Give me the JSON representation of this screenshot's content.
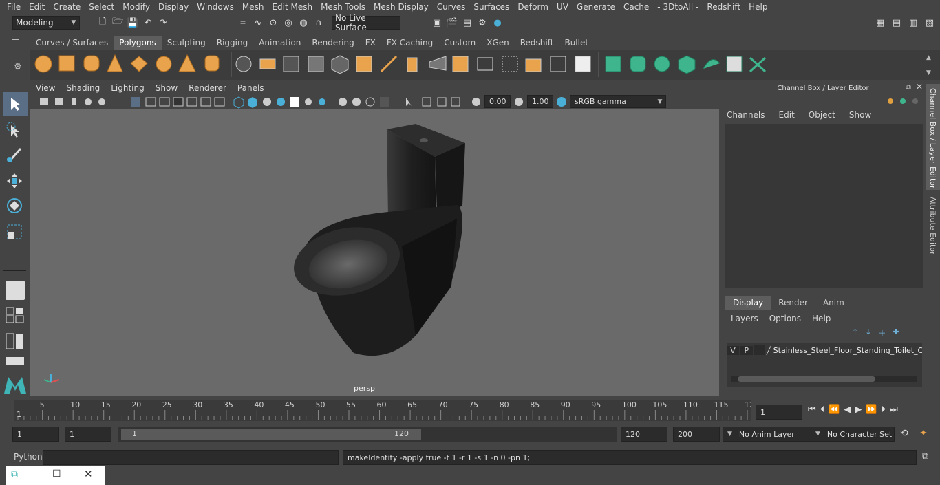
{
  "menu": [
    "File",
    "Edit",
    "Create",
    "Select",
    "Modify",
    "Display",
    "Windows",
    "Mesh",
    "Edit Mesh",
    "Mesh Tools",
    "Mesh Display",
    "Curves",
    "Surfaces",
    "Deform",
    "UV",
    "Generate",
    "Cache",
    "- 3DtoAll -",
    "Redshift",
    "Help"
  ],
  "mode_select": "Modeling",
  "live_surface": "No Live Surface",
  "shelf_tabs": [
    "Curves / Surfaces",
    "Polygons",
    "Sculpting",
    "Rigging",
    "Animation",
    "Rendering",
    "FX",
    "FX Caching",
    "Custom",
    "XGen",
    "Redshift",
    "Bullet"
  ],
  "shelf_active": "Polygons",
  "viewport_menu": [
    "View",
    "Shading",
    "Lighting",
    "Show",
    "Renderer",
    "Panels"
  ],
  "exposure": "0.00",
  "gamma": "1.00",
  "color_space": "sRGB gamma",
  "camera_label": "persp",
  "right_panel": {
    "title": "Channel Box / Layer Editor",
    "menu": [
      "Channels",
      "Edit",
      "Object",
      "Show"
    ],
    "tabs": [
      "Display",
      "Render",
      "Anim"
    ],
    "active_tab": "Display",
    "layer_menu": [
      "Layers",
      "Options",
      "Help"
    ],
    "layer": {
      "v": "V",
      "p": "P",
      "name": "Stainless_Steel_Floor_Standing_Toilet_C"
    },
    "side_tabs": [
      "Channel Box / Layer Editor",
      "Attribute Editor"
    ]
  },
  "timeline": {
    "ticks": [
      "5",
      "10",
      "15",
      "20",
      "25",
      "30",
      "35",
      "40",
      "45",
      "50",
      "55",
      "60",
      "65",
      "70",
      "75",
      "80",
      "85",
      "90",
      "95",
      "100",
      "105",
      "110",
      "115",
      "12"
    ],
    "start_marker": "1",
    "current_frame": "1"
  },
  "range": {
    "start": "1",
    "start2": "1",
    "slider_start": "1",
    "slider_end": "120",
    "end": "120",
    "max": "200",
    "anim_layer": "No Anim Layer",
    "char_set": "No Character Set"
  },
  "command": {
    "lang": "Python",
    "output": "makeIdentity -apply true -t 1 -r 1 -s 1 -n 0 -pn 1;"
  },
  "colors": {
    "shelf_orange": "#e8a34c",
    "shelf_green": "#3fb58e",
    "active_tab": "#5d5d5d"
  }
}
